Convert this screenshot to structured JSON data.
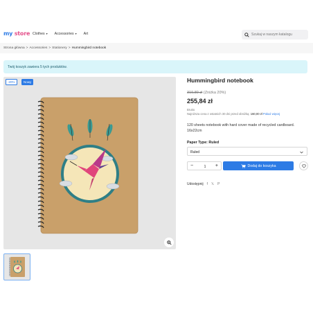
{
  "header": {
    "logo_my": "my",
    "logo_store": "store",
    "nav": [
      {
        "label": "Clothes",
        "caret": "▾"
      },
      {
        "label": "Accessories",
        "caret": "▾"
      },
      {
        "label": "Art",
        "caret": ""
      }
    ],
    "search_placeholder": "Szukaj w naszym katalogu"
  },
  "breadcrumb": {
    "items": [
      "Strona główna",
      "Accessories",
      "Stationery"
    ],
    "current": "Hummingbird notebook",
    "separator": ">"
  },
  "alert": {
    "text": "Twój koszyk zawiera 5 tych produktów."
  },
  "product": {
    "badges": {
      "discount": "-20%",
      "new": "Nowy"
    },
    "title": "Hummingbird notebook",
    "old_price": "319,80 zł",
    "discount_text": "(Zniżka 20%)",
    "price": "255,84 zł",
    "tax_label": "Brutto",
    "lowest_price_label": "Najniższa cena z ostatnich 30 dni przed obniżką:",
    "lowest_price": "160,00 zł",
    "lowest_more": "Pokaż więcej",
    "description": "120 sheets notebook with hard cover made of recycled cardboard. 16x22cm",
    "paper_type_label": "Paper Type: Ruled",
    "paper_type_selected": "Ruled",
    "quantity": "1",
    "minus": "−",
    "plus": "+",
    "add_to_cart": "Dodaj do koszyka",
    "share_label": "Udostępnij",
    "share_icons": [
      "f",
      "𝕏",
      "P"
    ]
  },
  "colors": {
    "accent": "#2d7be5",
    "logo_pink": "#e4508a",
    "alert_bg": "#d9f5fa",
    "notebook_cover": "#c9a06a"
  }
}
